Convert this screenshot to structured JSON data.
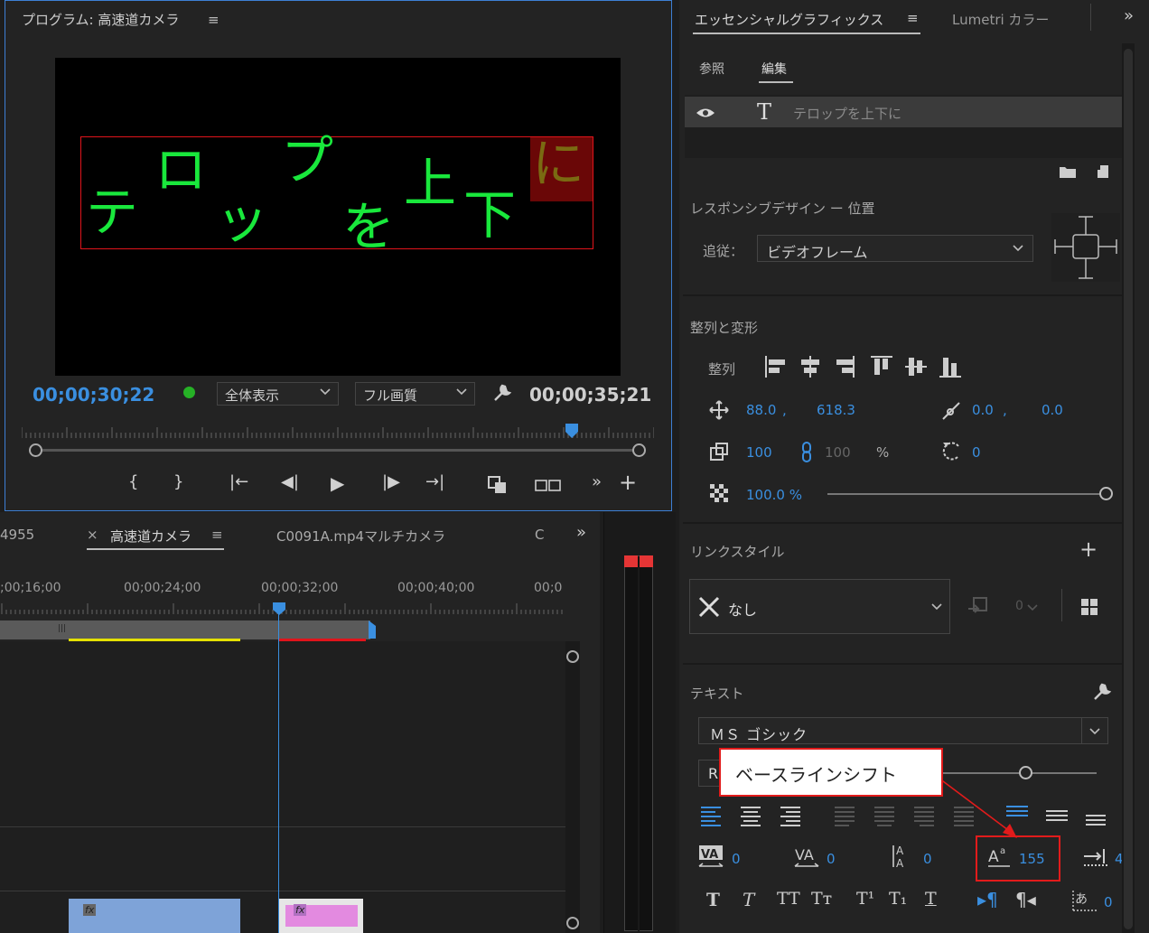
{
  "program": {
    "title": "プログラム: 高速道カメラ",
    "menu": "≡",
    "caption": {
      "chars": [
        "テ",
        "ロ",
        "ッ",
        "プ",
        "を",
        "上",
        "下",
        "に"
      ]
    },
    "timecode_current": "00;00;30;22",
    "zoom": "全体表示",
    "quality": "フル画質",
    "timecode_duration": "00;00;35;21",
    "playhead_fraction": 0.87
  },
  "timeline": {
    "tab_left": "4955",
    "tab_active_close": "×",
    "tab_active": "高速道カメラ",
    "tab_active_menu": "≡",
    "tab_other": "C0091A.mp4マルチカメラ",
    "tab_cut": "C",
    "overflow": "»",
    "ruler_labels": [
      ";00;16;00",
      "00;00;24;00",
      "00;00;32;00",
      "00;00;40;00",
      "00;0"
    ],
    "clip_fx_label": "fx"
  },
  "essential_graphics": {
    "tab_active": "エッセンシャルグラフィックス",
    "tab_menu": "≡",
    "tab_other": "Lumetri カラー",
    "overflow": "»",
    "subtab_browse": "参照",
    "subtab_edit": "編集",
    "layer_name": "テロップを上下に",
    "responsive_title": "レスポンシブデザイン ー 位置",
    "follow_label": "追従：",
    "follow_value": "ビデオフレーム",
    "align_title": "整列と変形",
    "align_label": "整列",
    "pos_x": "88.0",
    "pos_sep": ",",
    "pos_y": "618.3",
    "anchor_x": "0.0",
    "anchor_sep": ",",
    "anchor_y": "0.0",
    "scale": "100",
    "scale_locked": "100",
    "scale_unit": "%",
    "rotation": "0",
    "opacity": "100.0 %",
    "link_style_title": "リンクスタイル",
    "link_style_value": "なし",
    "link_count": "0",
    "text_title": "テキスト",
    "font": "ＭＳ ゴシック",
    "font_style_cut": "R",
    "kerning": "0",
    "tracking": "0",
    "leading": "0",
    "baseline_shift": "155",
    "tab_stops_cut": "4",
    "tsume": "0",
    "style_buttons": [
      "T",
      "T",
      "TT",
      "Tт",
      "T¹",
      "T₁",
      "T"
    ]
  },
  "callout": {
    "text": "ベースラインシフト"
  },
  "colors": {
    "accent": "#3a8fe0",
    "caption_green": "#19e83c",
    "selection_red": "#e0141b"
  }
}
